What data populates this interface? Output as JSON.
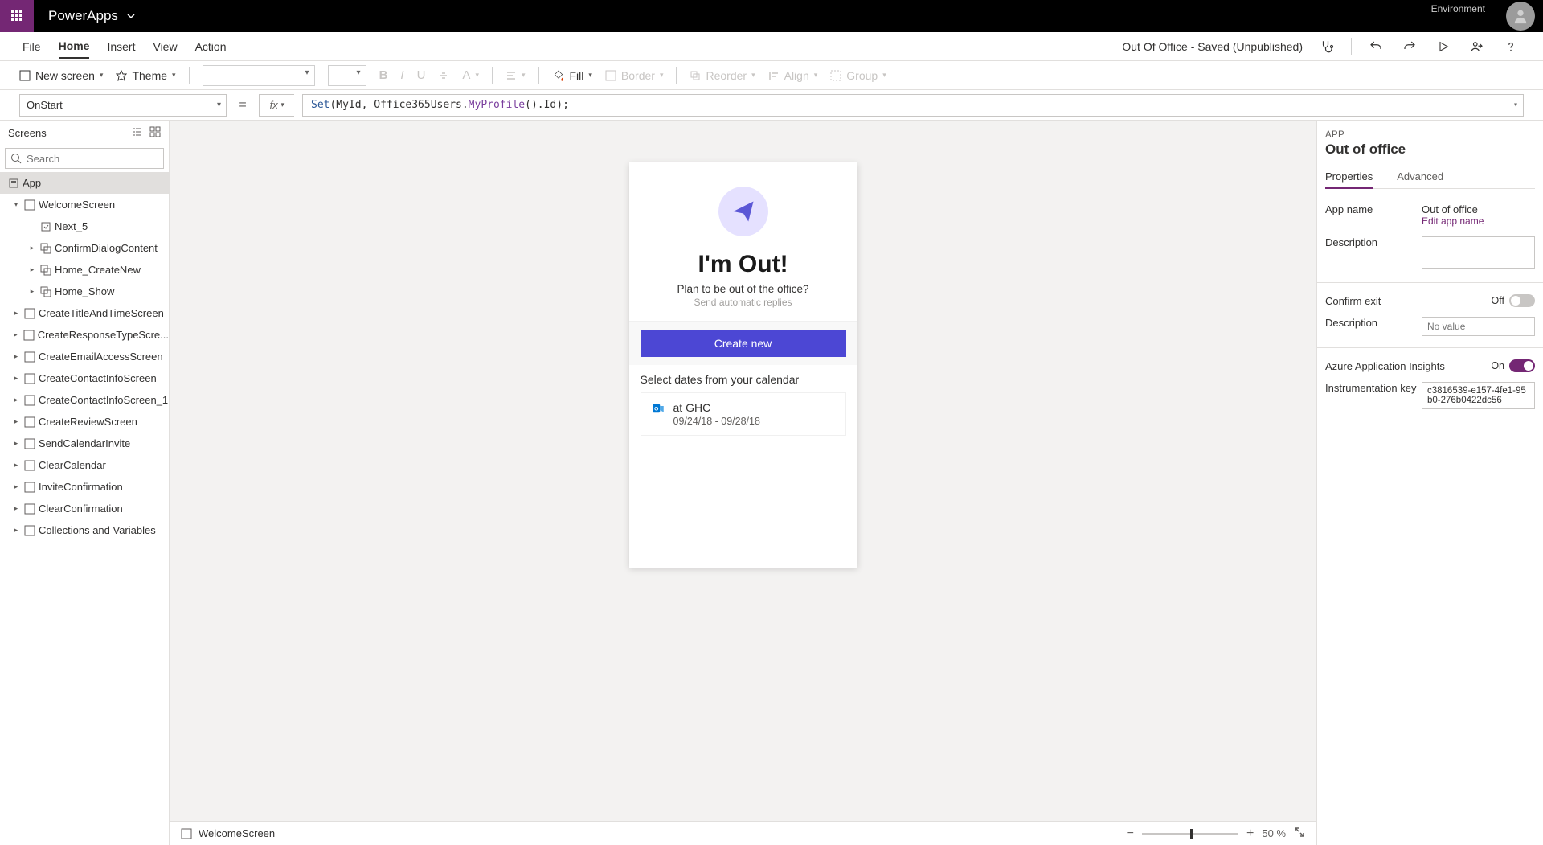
{
  "header": {
    "brand": "PowerApps",
    "env_label": "Environment"
  },
  "menu": {
    "items": [
      "File",
      "Home",
      "Insert",
      "View",
      "Action"
    ],
    "active_index": 1,
    "status": "Out Of Office - Saved (Unpublished)"
  },
  "toolbar": {
    "new_screen": "New screen",
    "theme": "Theme",
    "fill": "Fill",
    "border": "Border",
    "reorder": "Reorder",
    "align": "Align",
    "group": "Group"
  },
  "formula": {
    "property": "OnStart",
    "fx_label": "fx",
    "tokens": [
      {
        "t": "Set",
        "c": "tok-fn"
      },
      {
        "t": "(MyId, Office365Users.",
        "c": ""
      },
      {
        "t": "MyProfile",
        "c": "tok-prop"
      },
      {
        "t": "().Id);",
        "c": ""
      }
    ]
  },
  "left": {
    "title": "Screens",
    "search_placeholder": "Search",
    "app_label": "App",
    "tree": [
      {
        "label": "WelcomeScreen",
        "depth": 1,
        "chev": "▾",
        "icon": "screen"
      },
      {
        "label": "Next_5",
        "depth": 2,
        "chev": "",
        "icon": "control"
      },
      {
        "label": "ConfirmDialogContent",
        "depth": 2,
        "chev": "▸",
        "icon": "group"
      },
      {
        "label": "Home_CreateNew",
        "depth": 2,
        "chev": "▸",
        "icon": "group"
      },
      {
        "label": "Home_Show",
        "depth": 2,
        "chev": "▸",
        "icon": "group"
      },
      {
        "label": "CreateTitleAndTimeScreen",
        "depth": 1,
        "chev": "▸",
        "icon": "screen"
      },
      {
        "label": "CreateResponseTypeScre...",
        "depth": 1,
        "chev": "▸",
        "icon": "screen"
      },
      {
        "label": "CreateEmailAccessScreen",
        "depth": 1,
        "chev": "▸",
        "icon": "screen"
      },
      {
        "label": "CreateContactInfoScreen",
        "depth": 1,
        "chev": "▸",
        "icon": "screen"
      },
      {
        "label": "CreateContactInfoScreen_1",
        "depth": 1,
        "chev": "▸",
        "icon": "screen"
      },
      {
        "label": "CreateReviewScreen",
        "depth": 1,
        "chev": "▸",
        "icon": "screen"
      },
      {
        "label": "SendCalendarInvite",
        "depth": 1,
        "chev": "▸",
        "icon": "screen"
      },
      {
        "label": "ClearCalendar",
        "depth": 1,
        "chev": "▸",
        "icon": "screen"
      },
      {
        "label": "InviteConfirmation",
        "depth": 1,
        "chev": "▸",
        "icon": "screen"
      },
      {
        "label": "ClearConfirmation",
        "depth": 1,
        "chev": "▸",
        "icon": "screen"
      },
      {
        "label": "Collections and Variables",
        "depth": 1,
        "chev": "▸",
        "icon": "screen"
      }
    ]
  },
  "canvas": {
    "hero_title": "I'm Out!",
    "hero_sub": "Plan to be out of the office?",
    "hero_sub2": "Send automatic replies",
    "create_btn": "Create new",
    "cal_title": "Select dates from your calendar",
    "cal_item_title": "at GHC",
    "cal_item_date": "09/24/18 - 09/28/18",
    "status_screen": "WelcomeScreen",
    "zoom": "50",
    "zoom_unit": "%"
  },
  "right": {
    "section_label": "APP",
    "title": "Out of office",
    "tabs": [
      "Properties",
      "Advanced"
    ],
    "active_tab": 0,
    "app_name_label": "App name",
    "app_name_val": "Out of office",
    "edit_link": "Edit app name",
    "desc_label": "Description",
    "confirm_exit_label": "Confirm exit",
    "confirm_exit_state": "Off",
    "desc2_label": "Description",
    "desc2_placeholder": "No value",
    "insights_label": "Azure Application Insights",
    "insights_state": "On",
    "instr_key_label": "Instrumentation key",
    "instr_key_val": "c3816539-e157-4fe1-95b0-276b0422dc56"
  }
}
